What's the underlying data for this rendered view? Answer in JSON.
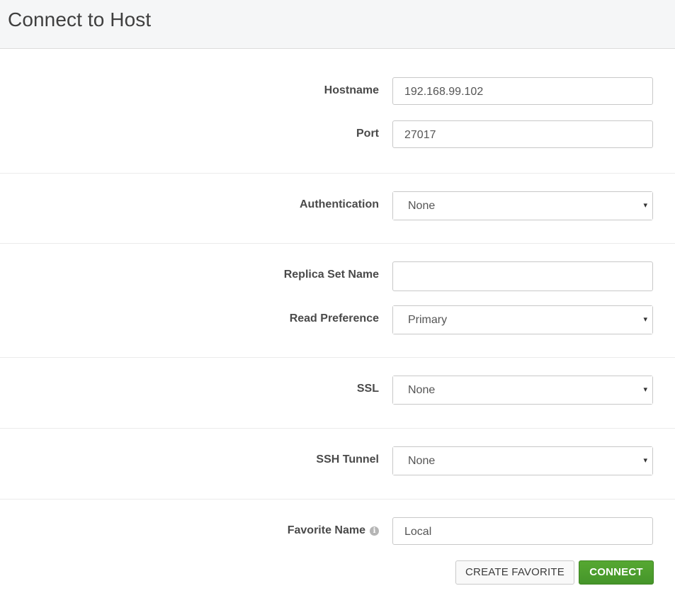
{
  "header": {
    "title": "Connect to Host"
  },
  "form": {
    "hostname": {
      "label": "Hostname",
      "value": "192.168.99.102"
    },
    "port": {
      "label": "Port",
      "value": "27017"
    },
    "authentication": {
      "label": "Authentication",
      "value": "None"
    },
    "replica_set_name": {
      "label": "Replica Set Name",
      "value": ""
    },
    "read_preference": {
      "label": "Read Preference",
      "value": "Primary"
    },
    "ssl": {
      "label": "SSL",
      "value": "None"
    },
    "ssh_tunnel": {
      "label": "SSH Tunnel",
      "value": "None"
    },
    "favorite_name": {
      "label": "Favorite Name",
      "value": "Local",
      "info_icon": "i"
    }
  },
  "actions": {
    "create_favorite_label": "CREATE FAVORITE",
    "connect_label": "CONNECT"
  },
  "icons": {
    "select_caret": "▾"
  },
  "colors": {
    "connect_button": "#4c9a2a",
    "header_background": "#f5f6f7"
  }
}
